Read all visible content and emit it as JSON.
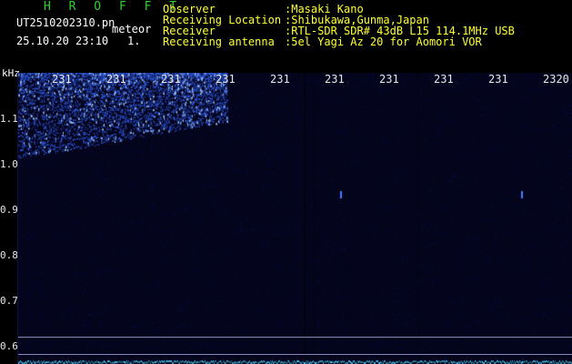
{
  "header": {
    "brand": "H R O F F T",
    "file_name": "UT2510202310.pn",
    "meteor_label": "meteor",
    "datetime": "25.10.20 23:10",
    "count": "1."
  },
  "meta": {
    "observer_label": "Observer",
    "observer_value": ":Masaki Kano",
    "location_label": "Receiving Location",
    "location_value": ":Shibukawa,Gunma,Japan",
    "receiver_label": "Receiver",
    "receiver_value": ":RTL-SDR SDR# 43dB L15 114.1MHz USB",
    "antenna_label": "Receiving antenna",
    "antenna_value": ":5el Yagi Az 20 for Aomori VOR"
  },
  "spectrogram": {
    "y_unit": "kHz",
    "y_ticks": [
      "1.1",
      "1.0",
      "0.9",
      "0.8",
      "0.7",
      "0.6"
    ],
    "x_ticks": [
      "231",
      "231",
      "231",
      "231",
      "231",
      "231",
      "231",
      "231",
      "231",
      "2320"
    ],
    "colors": {
      "background": "#04041c",
      "signal": "#3a63ff",
      "hot": "#9fc8ff"
    }
  }
}
